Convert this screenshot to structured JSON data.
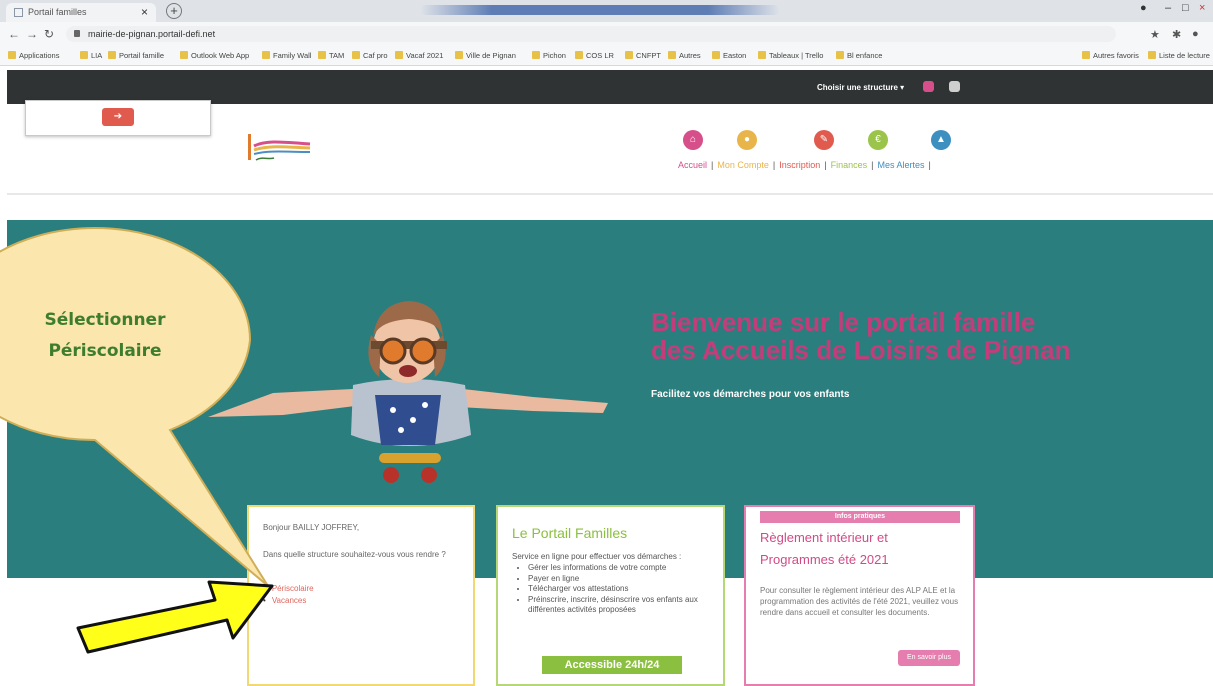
{
  "browser": {
    "tab_title": "Portail familles",
    "tab_close": "×",
    "new_tab": "+",
    "url": "mairie-de-pignan.portail-defi.net",
    "bookmarks": [
      "Applications",
      "LIA",
      "Portail famille",
      "Outlook Web App",
      "Family Wall",
      "TAM",
      "Caf pro",
      "Vacaf 2021",
      "Ville de Pignan",
      "Pichon",
      "COS LR",
      "CNFPT",
      "Autres",
      "Easton",
      "Tableaux | Trello",
      "Bl enfance"
    ],
    "bookmarks_right": [
      "Autres favoris",
      "Liste de lecture"
    ]
  },
  "site": {
    "structure_label": "Choisir une structure ▾",
    "login_icon": "➔",
    "nav": [
      {
        "label": "Accueil",
        "color": "#d64f8a",
        "icon": "home-icon",
        "glyph": "⌂"
      },
      {
        "label": "Mon Compte",
        "color": "#e8b54a",
        "icon": "user-icon",
        "glyph": "●"
      },
      {
        "label": "Inscription",
        "color": "#e05a4e",
        "icon": "pencil-icon",
        "glyph": "✎"
      },
      {
        "label": "Finances",
        "color": "#9bc44a",
        "icon": "euro-icon",
        "glyph": "€"
      },
      {
        "label": "Mes Alertes",
        "color": "#3c8fbf",
        "icon": "alert-icon",
        "glyph": "▲"
      }
    ],
    "hero": {
      "title_line1": "Bienvenue sur le portail famille",
      "title_line2": "des Accueils de Loisirs de Pignan",
      "subtitle": "Facilitez vos démarches pour vos enfants"
    },
    "card1": {
      "greeting": "Bonjour BAILLY JOFFREY,",
      "question": "Dans quelle structure souhaitez-vous vous rendre ?",
      "options": [
        "Périscolaire",
        "Vacances"
      ]
    },
    "card2": {
      "title": "Le Portail Familles",
      "intro": "Service en ligne pour effectuer vos démarches :",
      "items": [
        "Gérer les informations de votre compte",
        "Payer en ligne",
        "Télécharger vos attestations",
        "Préinscrire, inscrire, désinscrire vos enfants aux différentes activités proposées"
      ],
      "button": "Accessible 24h/24"
    },
    "card3": {
      "header": "Infos pratiques",
      "title": "Règlement intérieur et Programmes été 2021",
      "text": "Pour consulter le règlement intérieur des ALP ALE et la programmation des activités de l'été 2021, veuillez vous rendre dans accueil et consulter les documents.",
      "button": "En savoir plus"
    }
  },
  "annotation": {
    "line1": "Sélectionner",
    "line2": "Périscolaire"
  },
  "colors": {
    "hero_bg": "#2a7f7e",
    "accent_pink": "#c33d7a",
    "green": "#8bbf3f",
    "callout_fill": "#fbe6ad",
    "arrow_fill": "#ffff1a"
  }
}
